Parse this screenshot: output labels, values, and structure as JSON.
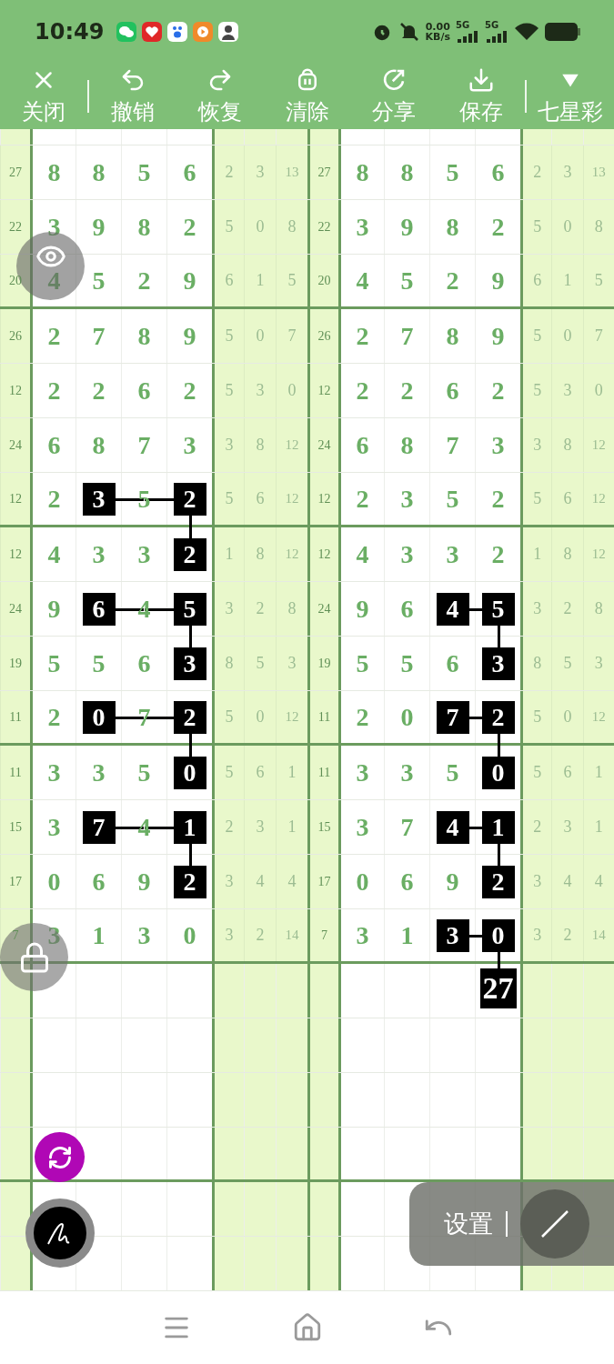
{
  "status_bar": {
    "time": "10:49",
    "speed_value": "0.00",
    "speed_unit": "KB/s",
    "networks": [
      "5G",
      "5G"
    ]
  },
  "toolbar": {
    "groups": [
      {
        "items": [
          {
            "kind": "close",
            "label": "关闭"
          }
        ]
      },
      {
        "items": [
          {
            "kind": "undo",
            "label": "撤销"
          },
          {
            "kind": "redo",
            "label": "恢复"
          },
          {
            "kind": "clear",
            "label": "清除"
          },
          {
            "kind": "share",
            "label": "分享"
          },
          {
            "kind": "save",
            "label": "保存"
          }
        ]
      },
      {
        "items": [
          {
            "kind": "dropdown",
            "label": "七星彩"
          }
        ]
      }
    ]
  },
  "rows": [
    {
      "left": {
        "index": "27",
        "digits": [
          {
            "value": "8",
            "marked": false,
            "link_right": false,
            "link_down": false
          },
          {
            "value": "8",
            "marked": false,
            "link_right": false,
            "link_down": false
          },
          {
            "value": "5",
            "marked": false,
            "link_right": false,
            "link_down": false
          },
          {
            "value": "6",
            "marked": false,
            "link_right": false,
            "link_down": false
          }
        ],
        "sums": [
          "2",
          "3",
          "13"
        ]
      },
      "right": {
        "index": "27",
        "digits": [
          {
            "value": "8",
            "marked": false,
            "link_right": false,
            "link_down": false
          },
          {
            "value": "8",
            "marked": false,
            "link_right": false,
            "link_down": false
          },
          {
            "value": "5",
            "marked": false,
            "link_right": false,
            "link_down": false
          },
          {
            "value": "6",
            "marked": false,
            "link_right": false,
            "link_down": false
          }
        ],
        "sums": [
          "2",
          "3",
          "13"
        ]
      }
    },
    {
      "left": {
        "index": "22",
        "digits": [
          {
            "value": "3",
            "marked": false,
            "link_right": false,
            "link_down": false
          },
          {
            "value": "9",
            "marked": false,
            "link_right": false,
            "link_down": false
          },
          {
            "value": "8",
            "marked": false,
            "link_right": false,
            "link_down": false
          },
          {
            "value": "2",
            "marked": false,
            "link_right": false,
            "link_down": false
          }
        ],
        "sums": [
          "5",
          "0",
          "8"
        ]
      },
      "right": {
        "index": "22",
        "digits": [
          {
            "value": "3",
            "marked": false,
            "link_right": false,
            "link_down": false
          },
          {
            "value": "9",
            "marked": false,
            "link_right": false,
            "link_down": false
          },
          {
            "value": "8",
            "marked": false,
            "link_right": false,
            "link_down": false
          },
          {
            "value": "2",
            "marked": false,
            "link_right": false,
            "link_down": false
          }
        ],
        "sums": [
          "5",
          "0",
          "8"
        ]
      }
    },
    {
      "left": {
        "index": "20",
        "digits": [
          {
            "value": "4",
            "marked": false,
            "link_right": false,
            "link_down": false
          },
          {
            "value": "5",
            "marked": false,
            "link_right": false,
            "link_down": false
          },
          {
            "value": "2",
            "marked": false,
            "link_right": false,
            "link_down": false
          },
          {
            "value": "9",
            "marked": false,
            "link_right": false,
            "link_down": false
          }
        ],
        "sums": [
          "6",
          "1",
          "5"
        ]
      },
      "right": {
        "index": "20",
        "digits": [
          {
            "value": "4",
            "marked": false,
            "link_right": false,
            "link_down": false
          },
          {
            "value": "5",
            "marked": false,
            "link_right": false,
            "link_down": false
          },
          {
            "value": "2",
            "marked": false,
            "link_right": false,
            "link_down": false
          },
          {
            "value": "9",
            "marked": false,
            "link_right": false,
            "link_down": false
          }
        ],
        "sums": [
          "6",
          "1",
          "5"
        ]
      }
    },
    {
      "left": {
        "index": "26",
        "digits": [
          {
            "value": "2",
            "marked": false,
            "link_right": false,
            "link_down": false
          },
          {
            "value": "7",
            "marked": false,
            "link_right": false,
            "link_down": false
          },
          {
            "value": "8",
            "marked": false,
            "link_right": false,
            "link_down": false
          },
          {
            "value": "9",
            "marked": false,
            "link_right": false,
            "link_down": false
          }
        ],
        "sums": [
          "5",
          "0",
          "7"
        ]
      },
      "right": {
        "index": "26",
        "digits": [
          {
            "value": "2",
            "marked": false,
            "link_right": false,
            "link_down": false
          },
          {
            "value": "7",
            "marked": false,
            "link_right": false,
            "link_down": false
          },
          {
            "value": "8",
            "marked": false,
            "link_right": false,
            "link_down": false
          },
          {
            "value": "9",
            "marked": false,
            "link_right": false,
            "link_down": false
          }
        ],
        "sums": [
          "5",
          "0",
          "7"
        ]
      }
    },
    {
      "left": {
        "index": "12",
        "digits": [
          {
            "value": "2",
            "marked": false,
            "link_right": false,
            "link_down": false
          },
          {
            "value": "2",
            "marked": false,
            "link_right": false,
            "link_down": false
          },
          {
            "value": "6",
            "marked": false,
            "link_right": false,
            "link_down": false
          },
          {
            "value": "2",
            "marked": false,
            "link_right": false,
            "link_down": false
          }
        ],
        "sums": [
          "5",
          "3",
          "0"
        ]
      },
      "right": {
        "index": "12",
        "digits": [
          {
            "value": "2",
            "marked": false,
            "link_right": false,
            "link_down": false
          },
          {
            "value": "2",
            "marked": false,
            "link_right": false,
            "link_down": false
          },
          {
            "value": "6",
            "marked": false,
            "link_right": false,
            "link_down": false
          },
          {
            "value": "2",
            "marked": false,
            "link_right": false,
            "link_down": false
          }
        ],
        "sums": [
          "5",
          "3",
          "0"
        ]
      }
    },
    {
      "left": {
        "index": "24",
        "digits": [
          {
            "value": "6",
            "marked": false,
            "link_right": false,
            "link_down": false
          },
          {
            "value": "8",
            "marked": false,
            "link_right": false,
            "link_down": false
          },
          {
            "value": "7",
            "marked": false,
            "link_right": false,
            "link_down": false
          },
          {
            "value": "3",
            "marked": false,
            "link_right": false,
            "link_down": false
          }
        ],
        "sums": [
          "3",
          "8",
          "12"
        ]
      },
      "right": {
        "index": "24",
        "digits": [
          {
            "value": "6",
            "marked": false,
            "link_right": false,
            "link_down": false
          },
          {
            "value": "8",
            "marked": false,
            "link_right": false,
            "link_down": false
          },
          {
            "value": "7",
            "marked": false,
            "link_right": false,
            "link_down": false
          },
          {
            "value": "3",
            "marked": false,
            "link_right": false,
            "link_down": false
          }
        ],
        "sums": [
          "3",
          "8",
          "12"
        ]
      }
    },
    {
      "left": {
        "index": "12",
        "digits": [
          {
            "value": "2",
            "marked": false,
            "link_right": false,
            "link_down": false
          },
          {
            "value": "3",
            "marked": true,
            "link_right": true,
            "link_down": false
          },
          {
            "value": "5",
            "marked": false,
            "link_right": true,
            "link_down": false
          },
          {
            "value": "2",
            "marked": true,
            "link_right": false,
            "link_down": true
          }
        ],
        "sums": [
          "5",
          "6",
          "12"
        ]
      },
      "right": {
        "index": "12",
        "digits": [
          {
            "value": "2",
            "marked": false,
            "link_right": false,
            "link_down": false
          },
          {
            "value": "3",
            "marked": false,
            "link_right": false,
            "link_down": false
          },
          {
            "value": "5",
            "marked": false,
            "link_right": false,
            "link_down": false
          },
          {
            "value": "2",
            "marked": false,
            "link_right": false,
            "link_down": false
          }
        ],
        "sums": [
          "5",
          "6",
          "12"
        ]
      }
    },
    {
      "left": {
        "index": "12",
        "digits": [
          {
            "value": "4",
            "marked": false,
            "link_right": false,
            "link_down": false
          },
          {
            "value": "3",
            "marked": false,
            "link_right": false,
            "link_down": false
          },
          {
            "value": "3",
            "marked": false,
            "link_right": false,
            "link_down": false
          },
          {
            "value": "2",
            "marked": true,
            "link_right": false,
            "link_down": false
          }
        ],
        "sums": [
          "1",
          "8",
          "12"
        ]
      },
      "right": {
        "index": "12",
        "digits": [
          {
            "value": "4",
            "marked": false,
            "link_right": false,
            "link_down": false
          },
          {
            "value": "3",
            "marked": false,
            "link_right": false,
            "link_down": false
          },
          {
            "value": "3",
            "marked": false,
            "link_right": false,
            "link_down": false
          },
          {
            "value": "2",
            "marked": false,
            "link_right": false,
            "link_down": false
          }
        ],
        "sums": [
          "1",
          "8",
          "12"
        ]
      }
    },
    {
      "left": {
        "index": "24",
        "digits": [
          {
            "value": "9",
            "marked": false,
            "link_right": false,
            "link_down": false
          },
          {
            "value": "6",
            "marked": true,
            "link_right": true,
            "link_down": false
          },
          {
            "value": "4",
            "marked": false,
            "link_right": true,
            "link_down": false
          },
          {
            "value": "5",
            "marked": true,
            "link_right": false,
            "link_down": true
          }
        ],
        "sums": [
          "3",
          "2",
          "8"
        ]
      },
      "right": {
        "index": "24",
        "digits": [
          {
            "value": "9",
            "marked": false,
            "link_right": false,
            "link_down": false
          },
          {
            "value": "6",
            "marked": false,
            "link_right": false,
            "link_down": false
          },
          {
            "value": "4",
            "marked": true,
            "link_right": true,
            "link_down": false
          },
          {
            "value": "5",
            "marked": true,
            "link_right": false,
            "link_down": true
          }
        ],
        "sums": [
          "3",
          "2",
          "8"
        ]
      }
    },
    {
      "left": {
        "index": "19",
        "digits": [
          {
            "value": "5",
            "marked": false,
            "link_right": false,
            "link_down": false
          },
          {
            "value": "5",
            "marked": false,
            "link_right": false,
            "link_down": false
          },
          {
            "value": "6",
            "marked": false,
            "link_right": false,
            "link_down": false
          },
          {
            "value": "3",
            "marked": true,
            "link_right": false,
            "link_down": false
          }
        ],
        "sums": [
          "8",
          "5",
          "3"
        ]
      },
      "right": {
        "index": "19",
        "digits": [
          {
            "value": "5",
            "marked": false,
            "link_right": false,
            "link_down": false
          },
          {
            "value": "5",
            "marked": false,
            "link_right": false,
            "link_down": false
          },
          {
            "value": "6",
            "marked": false,
            "link_right": false,
            "link_down": false
          },
          {
            "value": "3",
            "marked": true,
            "link_right": false,
            "link_down": false
          }
        ],
        "sums": [
          "8",
          "5",
          "3"
        ]
      }
    },
    {
      "left": {
        "index": "11",
        "digits": [
          {
            "value": "2",
            "marked": false,
            "link_right": false,
            "link_down": false
          },
          {
            "value": "0",
            "marked": true,
            "link_right": true,
            "link_down": false
          },
          {
            "value": "7",
            "marked": false,
            "link_right": true,
            "link_down": false
          },
          {
            "value": "2",
            "marked": true,
            "link_right": false,
            "link_down": true
          }
        ],
        "sums": [
          "5",
          "0",
          "12"
        ]
      },
      "right": {
        "index": "11",
        "digits": [
          {
            "value": "2",
            "marked": false,
            "link_right": false,
            "link_down": false
          },
          {
            "value": "0",
            "marked": false,
            "link_right": false,
            "link_down": false
          },
          {
            "value": "7",
            "marked": true,
            "link_right": true,
            "link_down": false
          },
          {
            "value": "2",
            "marked": true,
            "link_right": false,
            "link_down": true
          }
        ],
        "sums": [
          "5",
          "0",
          "12"
        ]
      }
    },
    {
      "left": {
        "index": "11",
        "digits": [
          {
            "value": "3",
            "marked": false,
            "link_right": false,
            "link_down": false
          },
          {
            "value": "3",
            "marked": false,
            "link_right": false,
            "link_down": false
          },
          {
            "value": "5",
            "marked": false,
            "link_right": false,
            "link_down": false
          },
          {
            "value": "0",
            "marked": true,
            "link_right": false,
            "link_down": false
          }
        ],
        "sums": [
          "5",
          "6",
          "1"
        ]
      },
      "right": {
        "index": "11",
        "digits": [
          {
            "value": "3",
            "marked": false,
            "link_right": false,
            "link_down": false
          },
          {
            "value": "3",
            "marked": false,
            "link_right": false,
            "link_down": false
          },
          {
            "value": "5",
            "marked": false,
            "link_right": false,
            "link_down": false
          },
          {
            "value": "0",
            "marked": true,
            "link_right": false,
            "link_down": false
          }
        ],
        "sums": [
          "5",
          "6",
          "1"
        ]
      }
    },
    {
      "left": {
        "index": "15",
        "digits": [
          {
            "value": "3",
            "marked": false,
            "link_right": false,
            "link_down": false
          },
          {
            "value": "7",
            "marked": true,
            "link_right": true,
            "link_down": false
          },
          {
            "value": "4",
            "marked": false,
            "link_right": true,
            "link_down": false
          },
          {
            "value": "1",
            "marked": true,
            "link_right": false,
            "link_down": true
          }
        ],
        "sums": [
          "2",
          "3",
          "1"
        ]
      },
      "right": {
        "index": "15",
        "digits": [
          {
            "value": "3",
            "marked": false,
            "link_right": false,
            "link_down": false
          },
          {
            "value": "7",
            "marked": false,
            "link_right": false,
            "link_down": false
          },
          {
            "value": "4",
            "marked": true,
            "link_right": true,
            "link_down": false
          },
          {
            "value": "1",
            "marked": true,
            "link_right": false,
            "link_down": true
          }
        ],
        "sums": [
          "2",
          "3",
          "1"
        ]
      }
    },
    {
      "left": {
        "index": "17",
        "digits": [
          {
            "value": "0",
            "marked": false,
            "link_right": false,
            "link_down": false
          },
          {
            "value": "6",
            "marked": false,
            "link_right": false,
            "link_down": false
          },
          {
            "value": "9",
            "marked": false,
            "link_right": false,
            "link_down": false
          },
          {
            "value": "2",
            "marked": true,
            "link_right": false,
            "link_down": false
          }
        ],
        "sums": [
          "3",
          "4",
          "4"
        ]
      },
      "right": {
        "index": "17",
        "digits": [
          {
            "value": "0",
            "marked": false,
            "link_right": false,
            "link_down": false
          },
          {
            "value": "6",
            "marked": false,
            "link_right": false,
            "link_down": false
          },
          {
            "value": "9",
            "marked": false,
            "link_right": false,
            "link_down": false
          },
          {
            "value": "2",
            "marked": true,
            "link_right": false,
            "link_down": false
          }
        ],
        "sums": [
          "3",
          "4",
          "4"
        ]
      }
    },
    {
      "left": {
        "index": "7",
        "digits": [
          {
            "value": "3",
            "marked": false,
            "link_right": false,
            "link_down": false
          },
          {
            "value": "1",
            "marked": false,
            "link_right": false,
            "link_down": false
          },
          {
            "value": "3",
            "marked": false,
            "link_right": false,
            "link_down": false
          },
          {
            "value": "0",
            "marked": false,
            "link_right": false,
            "link_down": false
          }
        ],
        "sums": [
          "3",
          "2",
          "14"
        ]
      },
      "right": {
        "index": "7",
        "digits": [
          {
            "value": "3",
            "marked": false,
            "link_right": false,
            "link_down": false
          },
          {
            "value": "1",
            "marked": false,
            "link_right": false,
            "link_down": false
          },
          {
            "value": "3",
            "marked": true,
            "link_right": true,
            "link_down": false
          },
          {
            "value": "0",
            "marked": true,
            "link_right": false,
            "link_down": true,
            "below": {
              "value": "27",
              "marked": true
            }
          }
        ],
        "sums": [
          "3",
          "2",
          "14"
        ]
      }
    }
  ],
  "settings": {
    "label": "设置"
  }
}
